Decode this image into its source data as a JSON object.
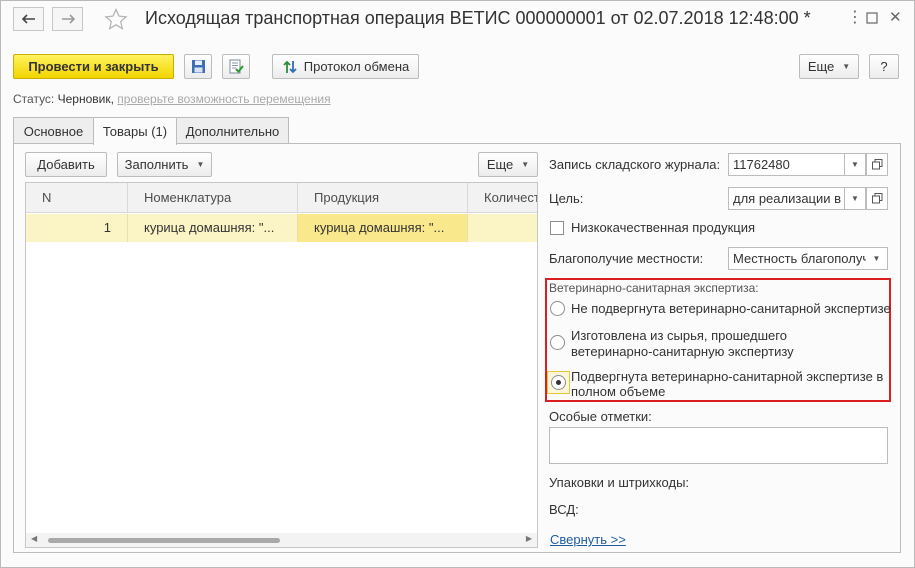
{
  "window": {
    "title": "Исходящая транспортная операция ВЕТИС 000000001 от 02.07.2018 12:48:00 *",
    "menu_icon": "kebab-menu-icon",
    "maximize_icon": "maximize-icon",
    "close_icon": "close-icon"
  },
  "toolbar": {
    "post_close_label": "Провести и закрыть",
    "exchange_protocol_label": "Протокол обмена",
    "more_label": "Еще",
    "help_label": "?"
  },
  "status": {
    "label": "Статус:",
    "value": "Черновик,",
    "link": "проверьте возможность перемещения"
  },
  "tabs": [
    {
      "label": "Основное"
    },
    {
      "label": "Товары (1)"
    },
    {
      "label": "Дополнительно"
    }
  ],
  "goods": {
    "add_label": "Добавить",
    "fill_label": "Заполнить",
    "more_label": "Еще",
    "columns": [
      "N",
      "Номенклатура",
      "Продукция",
      "Количест"
    ],
    "rows": [
      {
        "n": "1",
        "nomenclature": "курица домашняя: \"...",
        "product": "курица домашняя: \"...",
        "qty": ""
      }
    ]
  },
  "details": {
    "journal_label": "Запись складского журнала:",
    "journal_value": "11762480",
    "purpose_label": "Цель:",
    "purpose_value": "для реализации в п",
    "low_quality_label": "Низкокачественная продукция",
    "low_quality_checked": false,
    "wellbeing_label": "Благополучие местности:",
    "wellbeing_value": "Местность благополуч",
    "vet_exam_label": "Ветеринарно-санитарная экспертиза:",
    "vet_exam_options": [
      {
        "line1": "Не подвергнута ветеринарно-санитарной экспертизе",
        "line2": "",
        "selected": false
      },
      {
        "line1": "Изготовлена из сырья, прошедшего",
        "line2": "ветеринарно-санитарную экспертизу",
        "selected": false
      },
      {
        "line1": "Подвергнута ветеринарно-санитарной экспертизе в",
        "line2": "полном объеме",
        "selected": true
      }
    ],
    "special_marks_label": "Особые отметки:",
    "special_marks_value": "",
    "packaging_label": "Упаковки и штрихкоды:",
    "vsd_label": "ВСД:",
    "collapse_link": "Свернуть >>"
  },
  "colors": {
    "primary_button": "#f5dc14",
    "selected_row": "#fbf4c4",
    "highlight_frame": "#d91f1f",
    "link": "#1c5c9c"
  }
}
